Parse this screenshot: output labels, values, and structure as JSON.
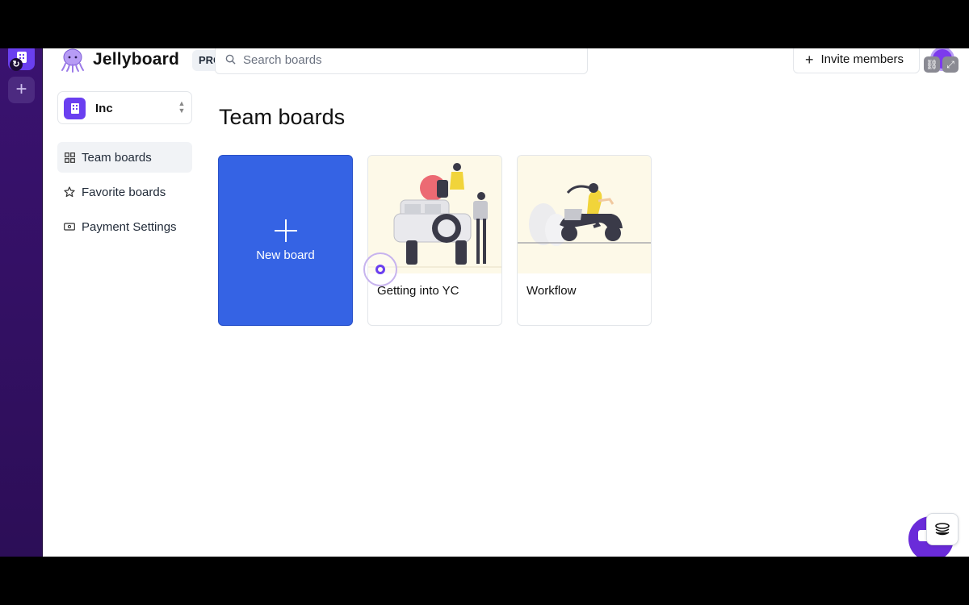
{
  "app": {
    "brand": "Jellyboard",
    "plan_badge": "PRO"
  },
  "header": {
    "search_placeholder": "Search boards",
    "invite_label": "Invite members"
  },
  "sidebar": {
    "workspace_name": "Inc",
    "items": [
      {
        "label": "Team boards",
        "icon": "grid-icon",
        "active": true
      },
      {
        "label": "Favorite boards",
        "icon": "star-icon",
        "active": false
      },
      {
        "label": "Payment Settings",
        "icon": "payment-icon",
        "active": false
      }
    ]
  },
  "main": {
    "title": "Team boards",
    "new_board_label": "New board",
    "boards": [
      {
        "title": "Getting into YC",
        "thumbnail": "jeep-illustration"
      },
      {
        "title": "Workflow",
        "thumbnail": "scooter-illustration"
      }
    ]
  },
  "colors": {
    "accent": "#3563e4",
    "rail": "#2c0e57",
    "brand_purple": "#6a3ff0",
    "thumb_bg": "#fdf9e8"
  }
}
